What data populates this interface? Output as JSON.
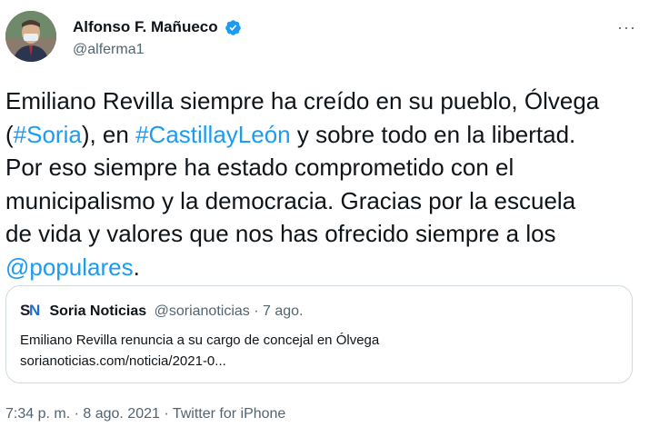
{
  "author": {
    "name": "Alfonso F. Mañueco",
    "handle": "@alferma1"
  },
  "more_label": "···",
  "tweet": {
    "line1": "Emiliano Revilla siempre ha creído en su pueblo, Ólvega",
    "line2_pre": "(",
    "hashtag_soria": "#Soria",
    "line2_mid": "), en ",
    "hashtag_cyl": "#CastillayLeón",
    "line2_post": " y sobre todo en la libertad.",
    "line3": "Por eso siempre ha estado comprometido con el",
    "line4": "municipalismo y la democracia. Gracias por la escuela",
    "line5": "de vida y valores que nos has ofrecido siempre a los",
    "mention": "@populares",
    "line6_post": "."
  },
  "quote": {
    "logo_s": "S",
    "logo_n": "N",
    "name": "Soria Noticias",
    "handle_date": "@sorianoticias · 7 ago.",
    "text": "Emiliano Revilla renuncia a su cargo de concejal en Ólvega",
    "link": "sorianoticias.com/noticia/2021-0..."
  },
  "footer": {
    "time": "7:34 p. m. · 8 ago. 2021 · ",
    "source": "Twitter for iPhone"
  },
  "colors": {
    "link": "#1d9bf0",
    "text": "#0f1419",
    "muted": "#536471",
    "border": "#cfd9de"
  }
}
